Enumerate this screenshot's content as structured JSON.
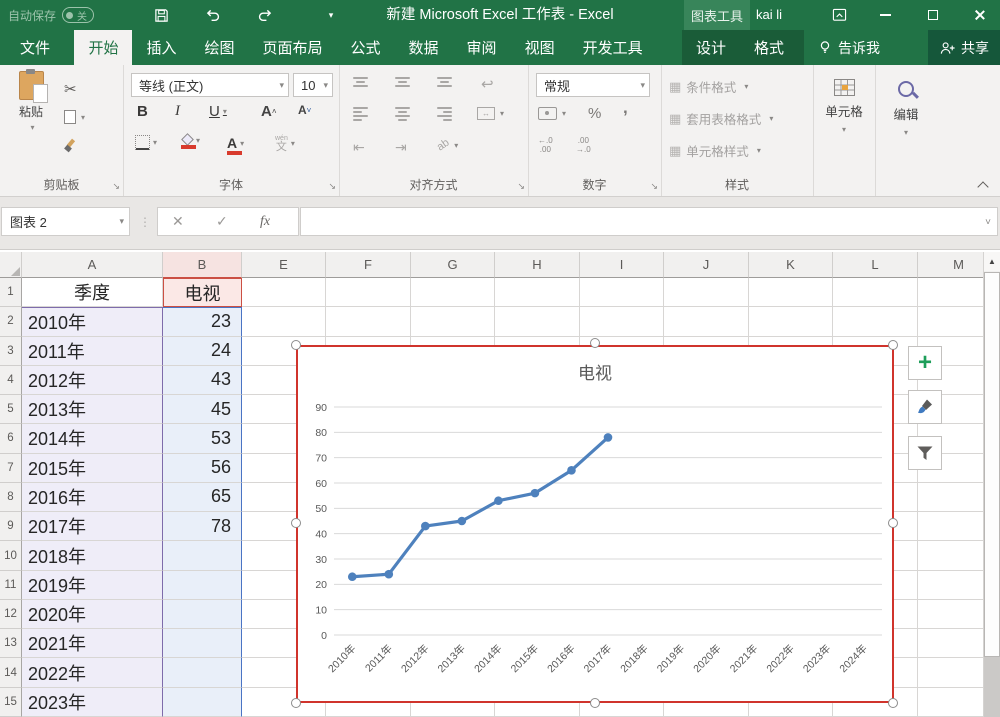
{
  "titlebar": {
    "autosave_label": "自动保存",
    "autosave_state": "关",
    "doc_title": "新建 Microsoft Excel 工作表 - Excel",
    "contextual_group": "图表工具",
    "user_name": "kai li"
  },
  "tabs": {
    "file": "文件",
    "main": [
      "开始",
      "插入",
      "绘图",
      "页面布局",
      "公式",
      "数据",
      "审阅",
      "视图",
      "开发工具"
    ],
    "active": "开始",
    "contextual": [
      "设计",
      "格式"
    ],
    "tell_me": "告诉我",
    "share": "共享"
  },
  "ribbon": {
    "clipboard": {
      "group_label": "剪贴板",
      "paste_label": "粘贴"
    },
    "font": {
      "group_label": "字体",
      "font_name": "等线 (正文)",
      "font_size": "10",
      "bold": "B",
      "italic": "I",
      "underline": "U",
      "pinyin_char": "文",
      "pinyin_hint": "wén"
    },
    "alignment": {
      "group_label": "对齐方式"
    },
    "number": {
      "group_label": "数字",
      "format": "常规",
      "percent": "%",
      "inc_decimal": "←.0\n.00",
      "dec_decimal": ".00\n→.0"
    },
    "styles": {
      "group_label": "样式",
      "items": [
        "条件格式",
        "套用表格格式",
        "单元格样式"
      ]
    },
    "cells": {
      "group_label": "单元格"
    },
    "editing": {
      "group_label": "编辑"
    }
  },
  "formula_bar": {
    "name_box_value": "图表 2",
    "fx_label": "fx"
  },
  "icons": {
    "cut": "✂",
    "wrap": "↩",
    "merge_arrow": "↔",
    "indent_left": "⇤",
    "indent_right": "⇥",
    "orientation": "ab",
    "comma": ",",
    "dots": "⋮",
    "launcher": "↘",
    "scroll_up": "▲",
    "cancel": "✕",
    "enter": "✓",
    "cond_format": "▦",
    "format_table": "▦",
    "cell_styles": "▦"
  },
  "grid": {
    "columns": [
      "A",
      "B",
      "E",
      "F",
      "G",
      "H",
      "I",
      "J",
      "K",
      "L",
      "M"
    ],
    "rows": [
      {
        "n": "1",
        "a": "季度",
        "b": "电视"
      },
      {
        "n": "2",
        "a": "2010年",
        "b": "23"
      },
      {
        "n": "3",
        "a": "2011年",
        "b": "24"
      },
      {
        "n": "4",
        "a": "2012年",
        "b": "43"
      },
      {
        "n": "5",
        "a": "2013年",
        "b": "45"
      },
      {
        "n": "6",
        "a": "2014年",
        "b": "53"
      },
      {
        "n": "7",
        "a": "2015年",
        "b": "56"
      },
      {
        "n": "8",
        "a": "2016年",
        "b": "65"
      },
      {
        "n": "9",
        "a": "2017年",
        "b": "78"
      },
      {
        "n": "10",
        "a": "2018年",
        "b": ""
      },
      {
        "n": "11",
        "a": "2019年",
        "b": ""
      },
      {
        "n": "12",
        "a": "2020年",
        "b": ""
      },
      {
        "n": "13",
        "a": "2021年",
        "b": ""
      },
      {
        "n": "14",
        "a": "2022年",
        "b": ""
      },
      {
        "n": "15",
        "a": "2023年",
        "b": ""
      }
    ]
  },
  "chart_data": {
    "type": "line",
    "title": "电视",
    "categories": [
      "2010年",
      "2011年",
      "2012年",
      "2013年",
      "2014年",
      "2015年",
      "2016年",
      "2017年",
      "2018年",
      "2019年",
      "2020年",
      "2021年",
      "2022年",
      "2023年",
      "2024年"
    ],
    "series": [
      {
        "name": "电视",
        "values": [
          23,
          24,
          43,
          45,
          53,
          56,
          65,
          78
        ]
      }
    ],
    "ylim": [
      0,
      90
    ],
    "ytick_step": 10,
    "xlabel": "",
    "ylabel": "",
    "grid": true,
    "legend": "none",
    "line_color": "#4e81bd",
    "marker": "circle",
    "selection_color": "#d0342c"
  }
}
